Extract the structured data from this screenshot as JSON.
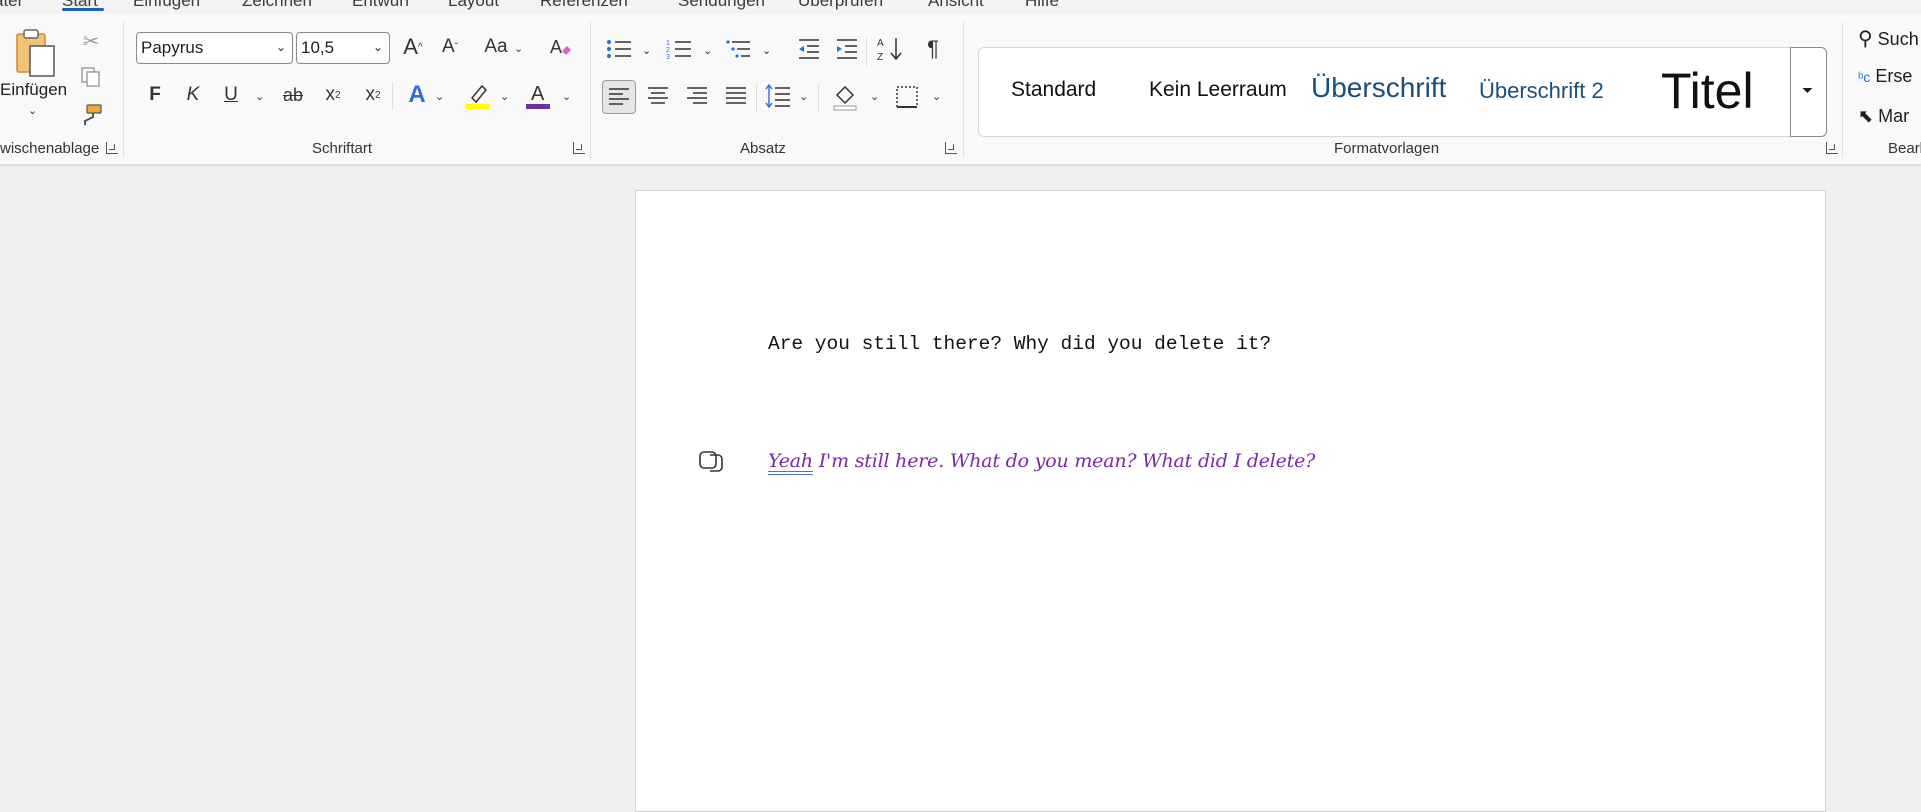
{
  "menubar": {
    "tabs": [
      "ater",
      "Start",
      "Einfügen",
      "Zeichnen",
      "Entwurf",
      "Layout",
      "Referenzen",
      "Sendungen",
      "Überprüfen",
      "Ansicht",
      "Hilfe"
    ],
    "active_tab": "Start"
  },
  "clipboard": {
    "paste_label": "Einfügen",
    "group_label": "wischenablage",
    "icons": [
      "paste-icon",
      "cut-icon",
      "copy-icon",
      "format-painter-icon"
    ]
  },
  "font": {
    "font_name": "Papyrus",
    "font_size": "10,5",
    "grow_label": "A",
    "shrink_label": "A",
    "case_label": "Aa",
    "bold_label": "F",
    "italic_label": "K",
    "underline_label": "U",
    "strike_label": "ab",
    "subscript_label": "x",
    "superscript_label": "x",
    "group_label": "Schriftart",
    "highlight_color": "#ffff00",
    "font_color": "#7030a0"
  },
  "paragraph": {
    "group_label": "Absatz",
    "pilcrow": "¶"
  },
  "styles": {
    "items": [
      "Standard",
      "Kein Leerraum",
      "Überschrift",
      "Überschrift 2",
      "Titel"
    ],
    "group_label": "Formatvorlagen"
  },
  "editing": {
    "search_label": "Such",
    "replace_label": "Erse",
    "select_label": "Mar",
    "group_label": "Bearb"
  },
  "document": {
    "line1": "Are you still there? Why did you delete it?",
    "line2_word": "Yeah",
    "line2_rest": " I'm still here. What do you mean? What did I delete?",
    "line2_color": "#7030a0"
  }
}
